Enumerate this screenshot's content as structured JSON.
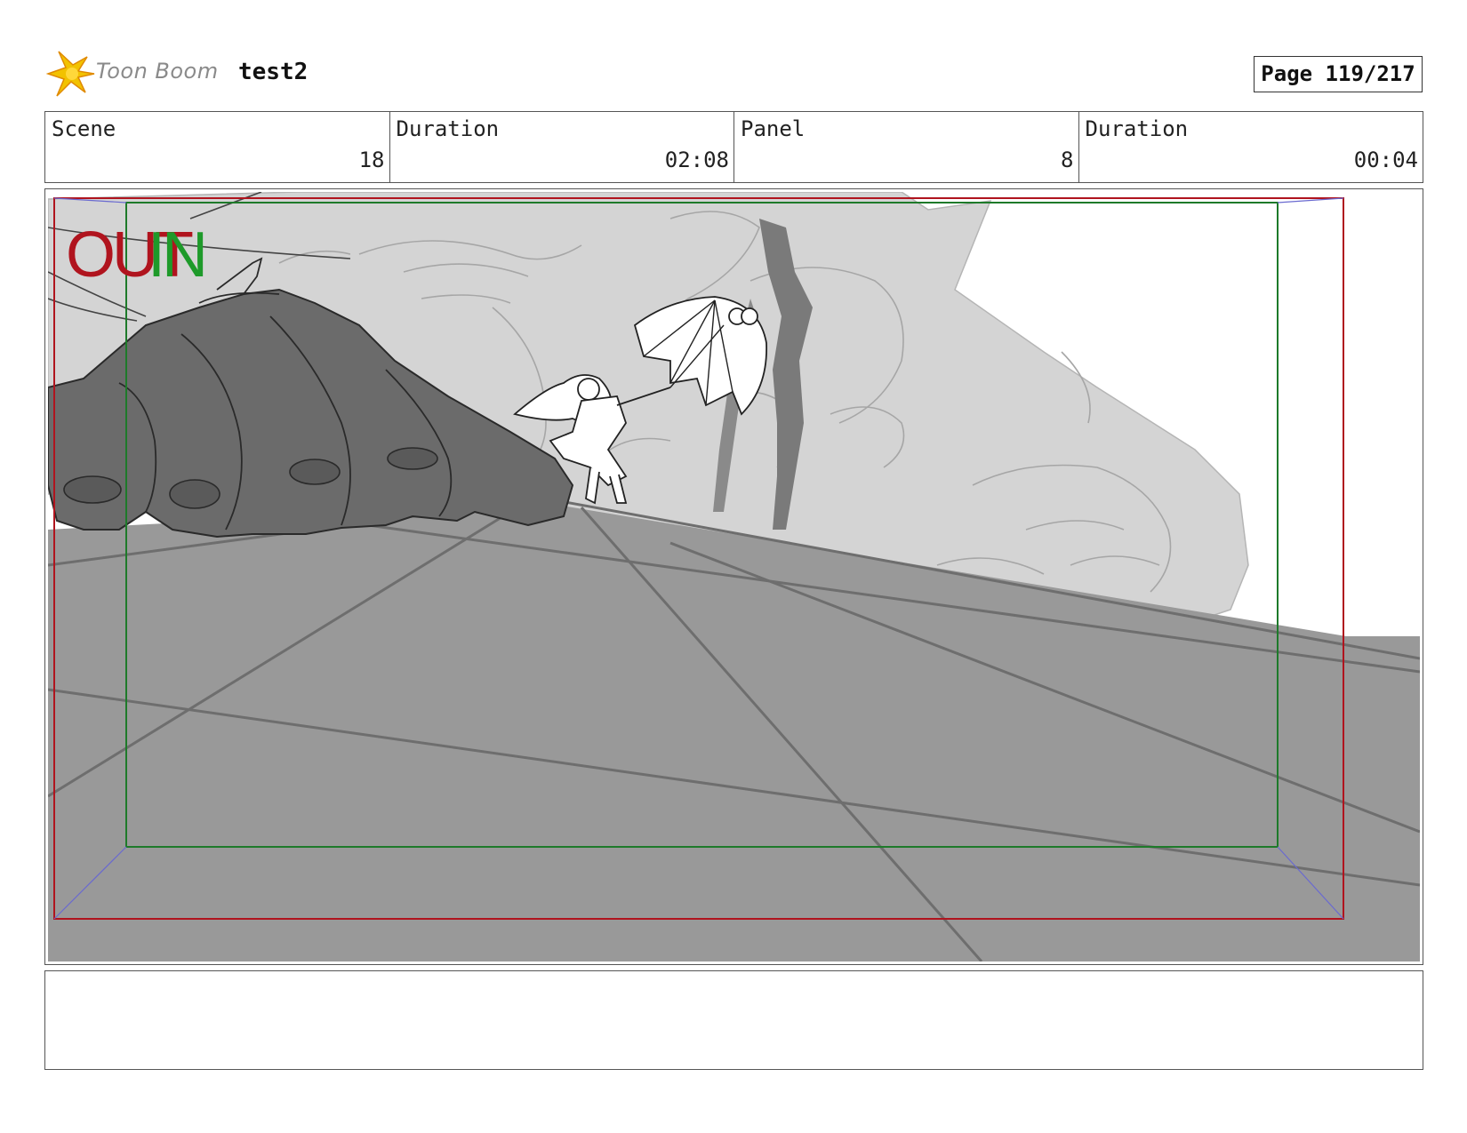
{
  "header": {
    "logo_text": "Toon Boom",
    "project_title": "test2",
    "page_label": "Page 119/217"
  },
  "info": {
    "scene_label": "Scene",
    "scene_value": "18",
    "scene_duration_label": "Duration",
    "scene_duration_value": "02:08",
    "panel_label": "Panel",
    "panel_value": "8",
    "panel_duration_label": "Duration",
    "panel_duration_value": "00:04"
  },
  "panel": {
    "out_label": "OUT",
    "in_label": "IN",
    "colors": {
      "out_frame": "#b0141e",
      "in_frame": "#1e7a2a",
      "ground": "#999999",
      "giant": "#d4d4d4",
      "hand": "#6b6b6b"
    }
  },
  "notes": {
    "text": ""
  }
}
